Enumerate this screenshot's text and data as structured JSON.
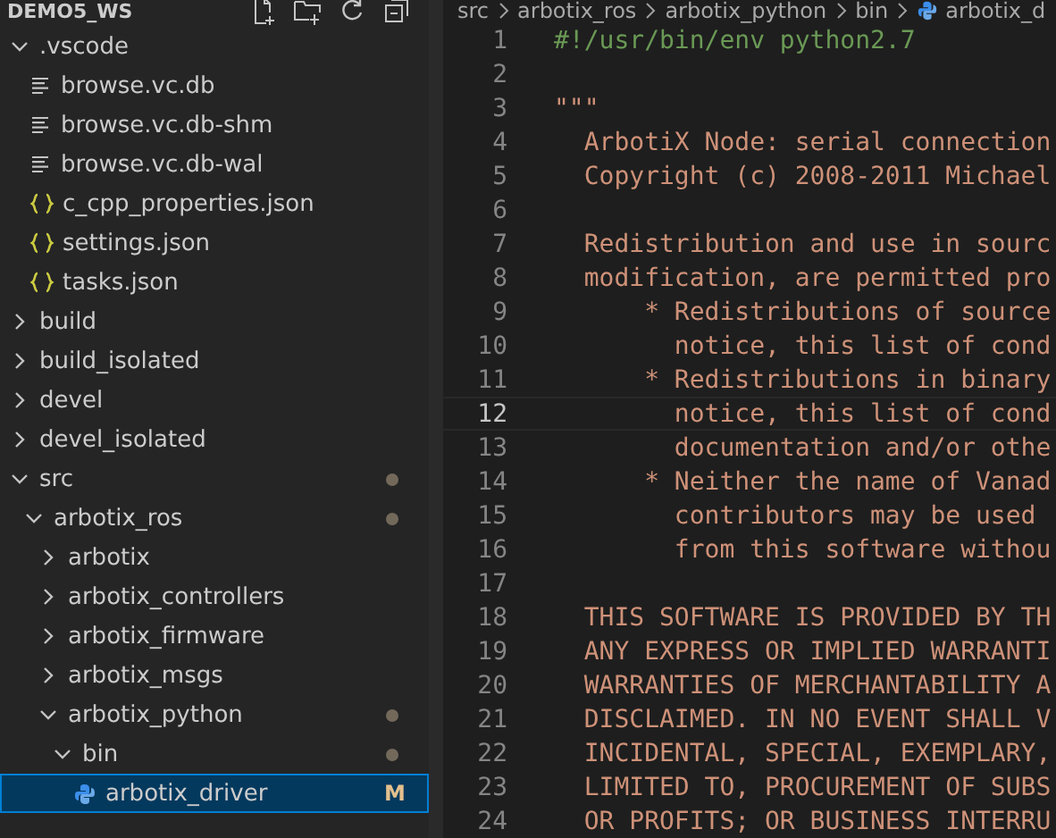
{
  "sidebar": {
    "title": "DEMO5_WS",
    "tree": [
      {
        "label": ".vscode",
        "kind": "folder",
        "expanded": true,
        "selected": false,
        "children": [
          {
            "label": "browse.vc.db",
            "kind": "text",
            "selected": false
          },
          {
            "label": "browse.vc.db-shm",
            "kind": "text",
            "selected": false
          },
          {
            "label": "browse.vc.db-wal",
            "kind": "text",
            "selected": false
          },
          {
            "label": "c_cpp_properties.json",
            "kind": "json",
            "selected": false
          },
          {
            "label": "settings.json",
            "kind": "json",
            "selected": false
          },
          {
            "label": "tasks.json",
            "kind": "json",
            "selected": false
          }
        ]
      },
      {
        "label": "build",
        "kind": "folder",
        "expanded": false,
        "selected": false
      },
      {
        "label": "build_isolated",
        "kind": "folder",
        "expanded": false,
        "selected": false
      },
      {
        "label": "devel",
        "kind": "folder",
        "expanded": false,
        "selected": false
      },
      {
        "label": "devel_isolated",
        "kind": "folder",
        "expanded": false,
        "selected": false
      },
      {
        "label": "src",
        "kind": "folder",
        "expanded": true,
        "modified": true,
        "selected": false,
        "children": [
          {
            "label": "arbotix_ros",
            "kind": "folder",
            "expanded": true,
            "modified": true,
            "selected": false,
            "children": [
              {
                "label": "arbotix",
                "kind": "folder",
                "expanded": false,
                "selected": false
              },
              {
                "label": "arbotix_controllers",
                "kind": "folder",
                "expanded": false,
                "selected": false
              },
              {
                "label": "arbotix_firmware",
                "kind": "folder",
                "expanded": false,
                "selected": false
              },
              {
                "label": "arbotix_msgs",
                "kind": "folder",
                "expanded": false,
                "selected": false
              },
              {
                "label": "arbotix_python",
                "kind": "folder",
                "expanded": true,
                "modified": true,
                "selected": false,
                "children": [
                  {
                    "label": "bin",
                    "kind": "folder",
                    "expanded": true,
                    "modified": true,
                    "selected": false,
                    "children": [
                      {
                        "label": "arbotix_driver",
                        "kind": "python",
                        "badge": "M",
                        "selected": true
                      }
                    ]
                  }
                ]
              }
            ]
          }
        ]
      }
    ]
  },
  "breadcrumb": [
    "src",
    "arbotix_ros",
    "arbotix_python",
    "bin",
    "arbotix_d"
  ],
  "editor": {
    "lines": [
      {
        "number": "1",
        "kind": "comment",
        "text": "#!/usr/bin/env python2.7",
        "current": false
      },
      {
        "number": "2",
        "current": false
      },
      {
        "number": "3",
        "kind": "string",
        "text": "\"\"\"",
        "current": false
      },
      {
        "number": "4",
        "kind": "string",
        "text": "  ArbotiX Node: serial connection",
        "current": false
      },
      {
        "number": "5",
        "kind": "string",
        "text": "  Copyright (c) 2008-2011 Michael",
        "current": false
      },
      {
        "number": "6",
        "current": false
      },
      {
        "number": "7",
        "kind": "string",
        "text": "  Redistribution and use in sourc",
        "current": false
      },
      {
        "number": "8",
        "kind": "string",
        "text": "  modification, are permitted pro",
        "current": false
      },
      {
        "number": "9",
        "kind": "string",
        "text": "      * Redistributions of source",
        "current": false
      },
      {
        "number": "10",
        "kind": "string",
        "text": "        notice, this list of cond",
        "current": false
      },
      {
        "number": "11",
        "kind": "string",
        "text": "      * Redistributions in binary",
        "current": false
      },
      {
        "number": "12",
        "kind": "string",
        "text": "        notice, this list of cond",
        "current": true
      },
      {
        "number": "13",
        "kind": "string",
        "text": "        documentation and/or othe",
        "current": false
      },
      {
        "number": "14",
        "kind": "string",
        "text": "      * Neither the name of Vanad",
        "current": false
      },
      {
        "number": "15",
        "kind": "string",
        "text": "        contributors may be used",
        "current": false
      },
      {
        "number": "16",
        "kind": "string",
        "text": "        from this software withou",
        "current": false
      },
      {
        "number": "17",
        "current": false
      },
      {
        "number": "18",
        "kind": "string",
        "text": "  THIS SOFTWARE IS PROVIDED BY TH",
        "current": false
      },
      {
        "number": "19",
        "kind": "string",
        "text": "  ANY EXPRESS OR IMPLIED WARRANTI",
        "current": false
      },
      {
        "number": "20",
        "kind": "string",
        "text": "  WARRANTIES OF MERCHANTABILITY A",
        "current": false
      },
      {
        "number": "21",
        "kind": "string",
        "text": "  DISCLAIMED. IN NO EVENT SHALL V",
        "current": false
      },
      {
        "number": "22",
        "kind": "string",
        "text": "  INCIDENTAL, SPECIAL, EXEMPLARY,",
        "current": false
      },
      {
        "number": "23",
        "kind": "string",
        "text": "  LIMITED TO, PROCUREMENT OF SUBS",
        "current": false
      },
      {
        "number": "24",
        "kind": "string",
        "text": "  OR PROFITS; OR BUSINESS INTERRU",
        "current": false
      }
    ]
  }
}
